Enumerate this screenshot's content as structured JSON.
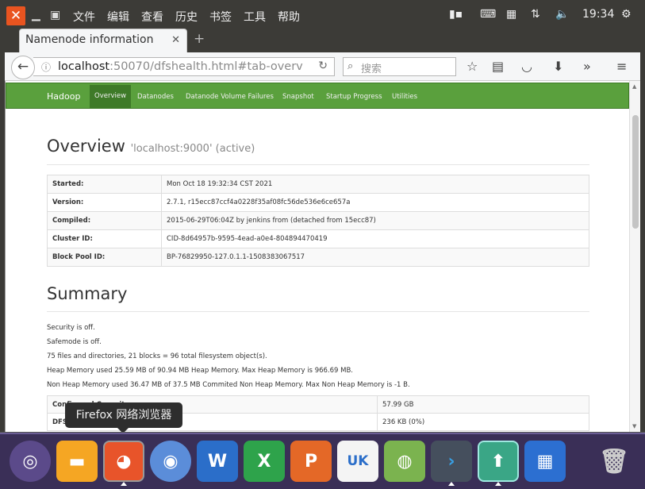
{
  "topbar": {
    "menu": [
      "文件",
      "编辑",
      "查看",
      "历史",
      "书签",
      "工具",
      "帮助"
    ],
    "time": "19:34"
  },
  "browser": {
    "tab_title": "Namenode information",
    "url_host": "localhost",
    "url_rest": ":50070/dfshealth.html#tab-overv",
    "search_placeholder": "搜索"
  },
  "hadoop_nav": {
    "brand": "Hadoop",
    "items": [
      "Overview",
      "Datanodes",
      "Datanode Volume Failures",
      "Snapshot",
      "Startup Progress",
      "Utilities"
    ]
  },
  "overview": {
    "title": "Overview",
    "subtitle": "'localhost:9000' (active)",
    "rows": [
      {
        "key": "Started:",
        "value": "Mon Oct 18 19:32:34 CST 2021"
      },
      {
        "key": "Version:",
        "value": "2.7.1, r15ecc87ccf4a0228f35af08fc56de536e6ce657a"
      },
      {
        "key": "Compiled:",
        "value": "2015-06-29T06:04Z by jenkins from (detached from 15ecc87)"
      },
      {
        "key": "Cluster ID:",
        "value": "CID-8d64957b-9595-4ead-a0e4-804894470419"
      },
      {
        "key": "Block Pool ID:",
        "value": "BP-76829950-127.0.1.1-1508383067517"
      }
    ]
  },
  "summary": {
    "title": "Summary",
    "lines": [
      "Security is off.",
      "Safemode is off.",
      "75 files and directories, 21 blocks = 96 total filesystem object(s).",
      "Heap Memory used 25.59 MB of 90.94 MB Heap Memory. Max Heap Memory is 966.69 MB.",
      "Non Heap Memory used 36.47 MB of 37.5 MB Commited Non Heap Memory. Max Non Heap Memory is -1 B."
    ],
    "rows": [
      {
        "key": "Configured Capacity:",
        "value": "57.99 GB"
      },
      {
        "key": "DFS Used:",
        "value": "236 KB (0%)"
      }
    ]
  },
  "dock": {
    "tooltip": "Firefox 网络浏览器",
    "uk_label": "UK"
  },
  "colors": {
    "hadoop_green": "#5aa03d",
    "ubuntu_orange": "#e95420",
    "dock_bg": "#3a2f57"
  }
}
